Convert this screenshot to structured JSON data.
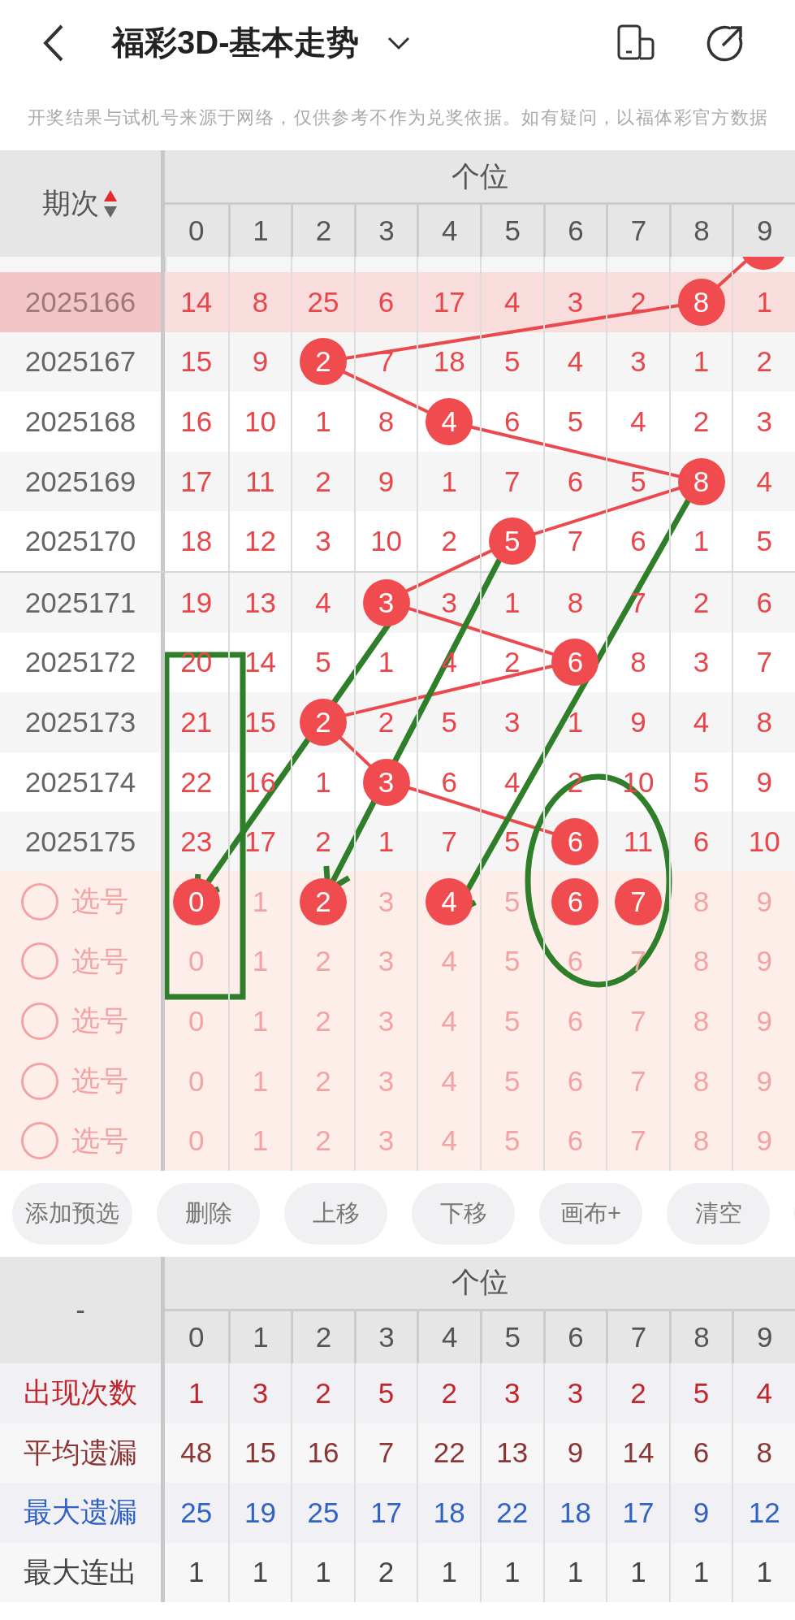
{
  "header": {
    "title": "福彩3D-基本走势"
  },
  "notice": "开奖结果与试机号来源于网络，仅供参考不作为兑奖依据。如有疑问，以福体彩官方数据",
  "trend_table": {
    "corner": "期次",
    "group": "个位",
    "columns": [
      "0",
      "1",
      "2",
      "3",
      "4",
      "5",
      "6",
      "7",
      "8",
      "9"
    ],
    "rows": [
      {
        "period": "2025166",
        "highlighted": true,
        "cells": [
          {
            "text": "14",
            "hit": false
          },
          {
            "text": "8",
            "hit": false
          },
          {
            "text": "25",
            "hit": false
          },
          {
            "text": "6",
            "hit": false
          },
          {
            "text": "17",
            "hit": false
          },
          {
            "text": "4",
            "hit": false
          },
          {
            "text": "3",
            "hit": false
          },
          {
            "text": "2",
            "hit": false
          },
          {
            "text": "8",
            "hit": true
          },
          {
            "text": "1",
            "hit": false
          }
        ]
      },
      {
        "period": "2025167",
        "highlighted": false,
        "cells": [
          {
            "text": "15",
            "hit": false
          },
          {
            "text": "9",
            "hit": false
          },
          {
            "text": "2",
            "hit": true
          },
          {
            "text": "7",
            "hit": false
          },
          {
            "text": "18",
            "hit": false
          },
          {
            "text": "5",
            "hit": false
          },
          {
            "text": "4",
            "hit": false
          },
          {
            "text": "3",
            "hit": false
          },
          {
            "text": "1",
            "hit": false
          },
          {
            "text": "2",
            "hit": false
          }
        ]
      },
      {
        "period": "2025168",
        "highlighted": false,
        "cells": [
          {
            "text": "16",
            "hit": false
          },
          {
            "text": "10",
            "hit": false
          },
          {
            "text": "1",
            "hit": false
          },
          {
            "text": "8",
            "hit": false
          },
          {
            "text": "4",
            "hit": true
          },
          {
            "text": "6",
            "hit": false
          },
          {
            "text": "5",
            "hit": false
          },
          {
            "text": "4",
            "hit": false
          },
          {
            "text": "2",
            "hit": false
          },
          {
            "text": "3",
            "hit": false
          }
        ]
      },
      {
        "period": "2025169",
        "highlighted": false,
        "cells": [
          {
            "text": "17",
            "hit": false
          },
          {
            "text": "11",
            "hit": false
          },
          {
            "text": "2",
            "hit": false
          },
          {
            "text": "9",
            "hit": false
          },
          {
            "text": "1",
            "hit": false
          },
          {
            "text": "7",
            "hit": false
          },
          {
            "text": "6",
            "hit": false
          },
          {
            "text": "5",
            "hit": false
          },
          {
            "text": "8",
            "hit": true
          },
          {
            "text": "4",
            "hit": false
          }
        ]
      },
      {
        "period": "2025170",
        "highlighted": false,
        "cells": [
          {
            "text": "18",
            "hit": false
          },
          {
            "text": "12",
            "hit": false
          },
          {
            "text": "3",
            "hit": false
          },
          {
            "text": "10",
            "hit": false
          },
          {
            "text": "2",
            "hit": false
          },
          {
            "text": "5",
            "hit": true
          },
          {
            "text": "7",
            "hit": false
          },
          {
            "text": "6",
            "hit": false
          },
          {
            "text": "1",
            "hit": false
          },
          {
            "text": "5",
            "hit": false
          }
        ]
      },
      {
        "period": "2025171",
        "highlighted": false,
        "cells": [
          {
            "text": "19",
            "hit": false
          },
          {
            "text": "13",
            "hit": false
          },
          {
            "text": "4",
            "hit": false
          },
          {
            "text": "3",
            "hit": true
          },
          {
            "text": "3",
            "hit": false
          },
          {
            "text": "1",
            "hit": false
          },
          {
            "text": "8",
            "hit": false
          },
          {
            "text": "7",
            "hit": false
          },
          {
            "text": "2",
            "hit": false
          },
          {
            "text": "6",
            "hit": false
          }
        ]
      },
      {
        "period": "2025172",
        "highlighted": false,
        "cells": [
          {
            "text": "20",
            "hit": false
          },
          {
            "text": "14",
            "hit": false
          },
          {
            "text": "5",
            "hit": false
          },
          {
            "text": "1",
            "hit": false
          },
          {
            "text": "4",
            "hit": false
          },
          {
            "text": "2",
            "hit": false
          },
          {
            "text": "6",
            "hit": true
          },
          {
            "text": "8",
            "hit": false
          },
          {
            "text": "3",
            "hit": false
          },
          {
            "text": "7",
            "hit": false
          }
        ]
      },
      {
        "period": "2025173",
        "highlighted": false,
        "cells": [
          {
            "text": "21",
            "hit": false
          },
          {
            "text": "15",
            "hit": false
          },
          {
            "text": "2",
            "hit": true
          },
          {
            "text": "2",
            "hit": false
          },
          {
            "text": "5",
            "hit": false
          },
          {
            "text": "3",
            "hit": false
          },
          {
            "text": "1",
            "hit": false
          },
          {
            "text": "9",
            "hit": false
          },
          {
            "text": "4",
            "hit": false
          },
          {
            "text": "8",
            "hit": false
          }
        ]
      },
      {
        "period": "2025174",
        "highlighted": false,
        "cells": [
          {
            "text": "22",
            "hit": false
          },
          {
            "text": "16",
            "hit": false
          },
          {
            "text": "1",
            "hit": false
          },
          {
            "text": "3",
            "hit": true
          },
          {
            "text": "6",
            "hit": false
          },
          {
            "text": "4",
            "hit": false
          },
          {
            "text": "2",
            "hit": false
          },
          {
            "text": "10",
            "hit": false
          },
          {
            "text": "5",
            "hit": false
          },
          {
            "text": "9",
            "hit": false
          }
        ]
      },
      {
        "period": "2025175",
        "highlighted": false,
        "cells": [
          {
            "text": "23",
            "hit": false
          },
          {
            "text": "17",
            "hit": false
          },
          {
            "text": "2",
            "hit": false
          },
          {
            "text": "1",
            "hit": false
          },
          {
            "text": "7",
            "hit": false
          },
          {
            "text": "5",
            "hit": false
          },
          {
            "text": "6",
            "hit": true
          },
          {
            "text": "11",
            "hit": false
          },
          {
            "text": "6",
            "hit": false
          },
          {
            "text": "10",
            "hit": false
          }
        ]
      }
    ],
    "pick_rows": [
      {
        "label": "选号",
        "checked": false,
        "numbers": [
          {
            "text": "0",
            "selected": true
          },
          {
            "text": "1",
            "selected": false
          },
          {
            "text": "2",
            "selected": true
          },
          {
            "text": "3",
            "selected": false
          },
          {
            "text": "4",
            "selected": true
          },
          {
            "text": "5",
            "selected": false
          },
          {
            "text": "6",
            "selected": true
          },
          {
            "text": "7",
            "selected": true
          },
          {
            "text": "8",
            "selected": false
          },
          {
            "text": "9",
            "selected": false
          }
        ]
      },
      {
        "label": "选号",
        "checked": false,
        "numbers": [
          {
            "text": "0",
            "selected": false
          },
          {
            "text": "1",
            "selected": false
          },
          {
            "text": "2",
            "selected": false
          },
          {
            "text": "3",
            "selected": false
          },
          {
            "text": "4",
            "selected": false
          },
          {
            "text": "5",
            "selected": false
          },
          {
            "text": "6",
            "selected": false
          },
          {
            "text": "7",
            "selected": false
          },
          {
            "text": "8",
            "selected": false
          },
          {
            "text": "9",
            "selected": false
          }
        ]
      },
      {
        "label": "选号",
        "checked": false,
        "numbers": [
          {
            "text": "0",
            "selected": false
          },
          {
            "text": "1",
            "selected": false
          },
          {
            "text": "2",
            "selected": false
          },
          {
            "text": "3",
            "selected": false
          },
          {
            "text": "4",
            "selected": false
          },
          {
            "text": "5",
            "selected": false
          },
          {
            "text": "6",
            "selected": false
          },
          {
            "text": "7",
            "selected": false
          },
          {
            "text": "8",
            "selected": false
          },
          {
            "text": "9",
            "selected": false
          }
        ]
      },
      {
        "label": "选号",
        "checked": false,
        "numbers": [
          {
            "text": "0",
            "selected": false
          },
          {
            "text": "1",
            "selected": false
          },
          {
            "text": "2",
            "selected": false
          },
          {
            "text": "3",
            "selected": false
          },
          {
            "text": "4",
            "selected": false
          },
          {
            "text": "5",
            "selected": false
          },
          {
            "text": "6",
            "selected": false
          },
          {
            "text": "7",
            "selected": false
          },
          {
            "text": "8",
            "selected": false
          },
          {
            "text": "9",
            "selected": false
          }
        ]
      },
      {
        "label": "选号",
        "checked": false,
        "numbers": [
          {
            "text": "0",
            "selected": false
          },
          {
            "text": "1",
            "selected": false
          },
          {
            "text": "2",
            "selected": false
          },
          {
            "text": "3",
            "selected": false
          },
          {
            "text": "4",
            "selected": false
          },
          {
            "text": "5",
            "selected": false
          },
          {
            "text": "6",
            "selected": false
          },
          {
            "text": "7",
            "selected": false
          },
          {
            "text": "8",
            "selected": false
          },
          {
            "text": "9",
            "selected": false
          }
        ]
      }
    ]
  },
  "actions": [
    "添加预选",
    "删除",
    "上移",
    "下移",
    "画布+",
    "清空"
  ],
  "stats_table": {
    "corner": "-",
    "group": "个位",
    "columns": [
      "0",
      "1",
      "2",
      "3",
      "4",
      "5",
      "6",
      "7",
      "8",
      "9"
    ],
    "rows": [
      {
        "label": "出现次数",
        "kind": "count",
        "values": [
          "1",
          "3",
          "2",
          "5",
          "2",
          "3",
          "3",
          "2",
          "5",
          "4"
        ]
      },
      {
        "label": "平均遗漏",
        "kind": "average",
        "values": [
          "48",
          "15",
          "16",
          "7",
          "22",
          "13",
          "9",
          "14",
          "6",
          "8"
        ]
      },
      {
        "label": "最大遗漏",
        "kind": "max",
        "values": [
          "25",
          "19",
          "25",
          "17",
          "18",
          "22",
          "18",
          "17",
          "9",
          "12"
        ]
      },
      {
        "label": "最大连出",
        "kind": "streak",
        "values": [
          "1",
          "1",
          "1",
          "2",
          "1",
          "1",
          "1",
          "1",
          "1",
          "1"
        ]
      }
    ]
  }
}
